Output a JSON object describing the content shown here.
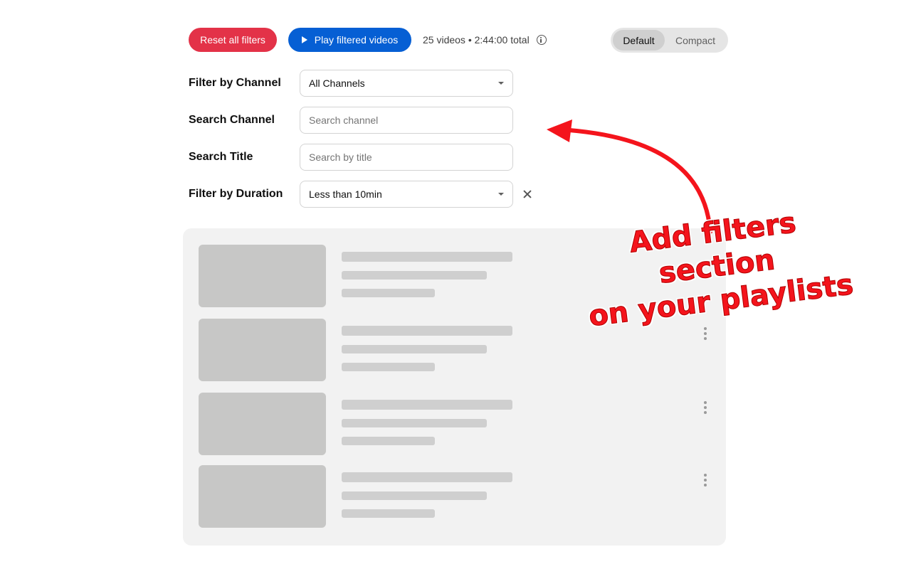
{
  "toolbar": {
    "reset_label": "Reset all filters",
    "play_label": "Play filtered videos",
    "summary_text": "25 videos • 2:44:00 total",
    "view_options": [
      "Default",
      "Compact"
    ],
    "active_view": "Default"
  },
  "filters": {
    "channel": {
      "label": "Filter by Channel",
      "value": "All Channels"
    },
    "search_channel": {
      "label": "Search Channel",
      "placeholder": "Search channel"
    },
    "search_title": {
      "label": "Search Title",
      "placeholder": "Search by title"
    },
    "duration": {
      "label": "Filter by Duration",
      "value": "Less than 10min"
    }
  },
  "playlist": {
    "item_count_visible": 4
  },
  "annotation": {
    "line1": "Add filters section",
    "line2": "on your playlists"
  },
  "colors": {
    "reset_button": "#e33248",
    "play_button": "#065fd4",
    "annotation": "#f4141c"
  },
  "icons": {
    "play": "play-icon",
    "info": "info-icon",
    "dropdown": "chevron-down-icon",
    "clear": "close-icon",
    "more": "more-vert-icon"
  }
}
